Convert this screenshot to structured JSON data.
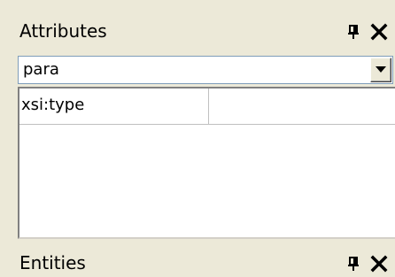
{
  "attributes_panel": {
    "title": "Attributes",
    "element_select": {
      "value": "para"
    },
    "rows": [
      {
        "name": "xsi:type",
        "value": ""
      }
    ]
  },
  "entities_panel": {
    "title": "Entities"
  },
  "icons": {
    "pin": "pin-icon",
    "close": "close-icon",
    "dropdown": "chevron-down-icon"
  },
  "colors": {
    "panel_background": "#ECE9D8",
    "content_background": "#FFFFFF",
    "grid_line": "#C0C0C0"
  }
}
